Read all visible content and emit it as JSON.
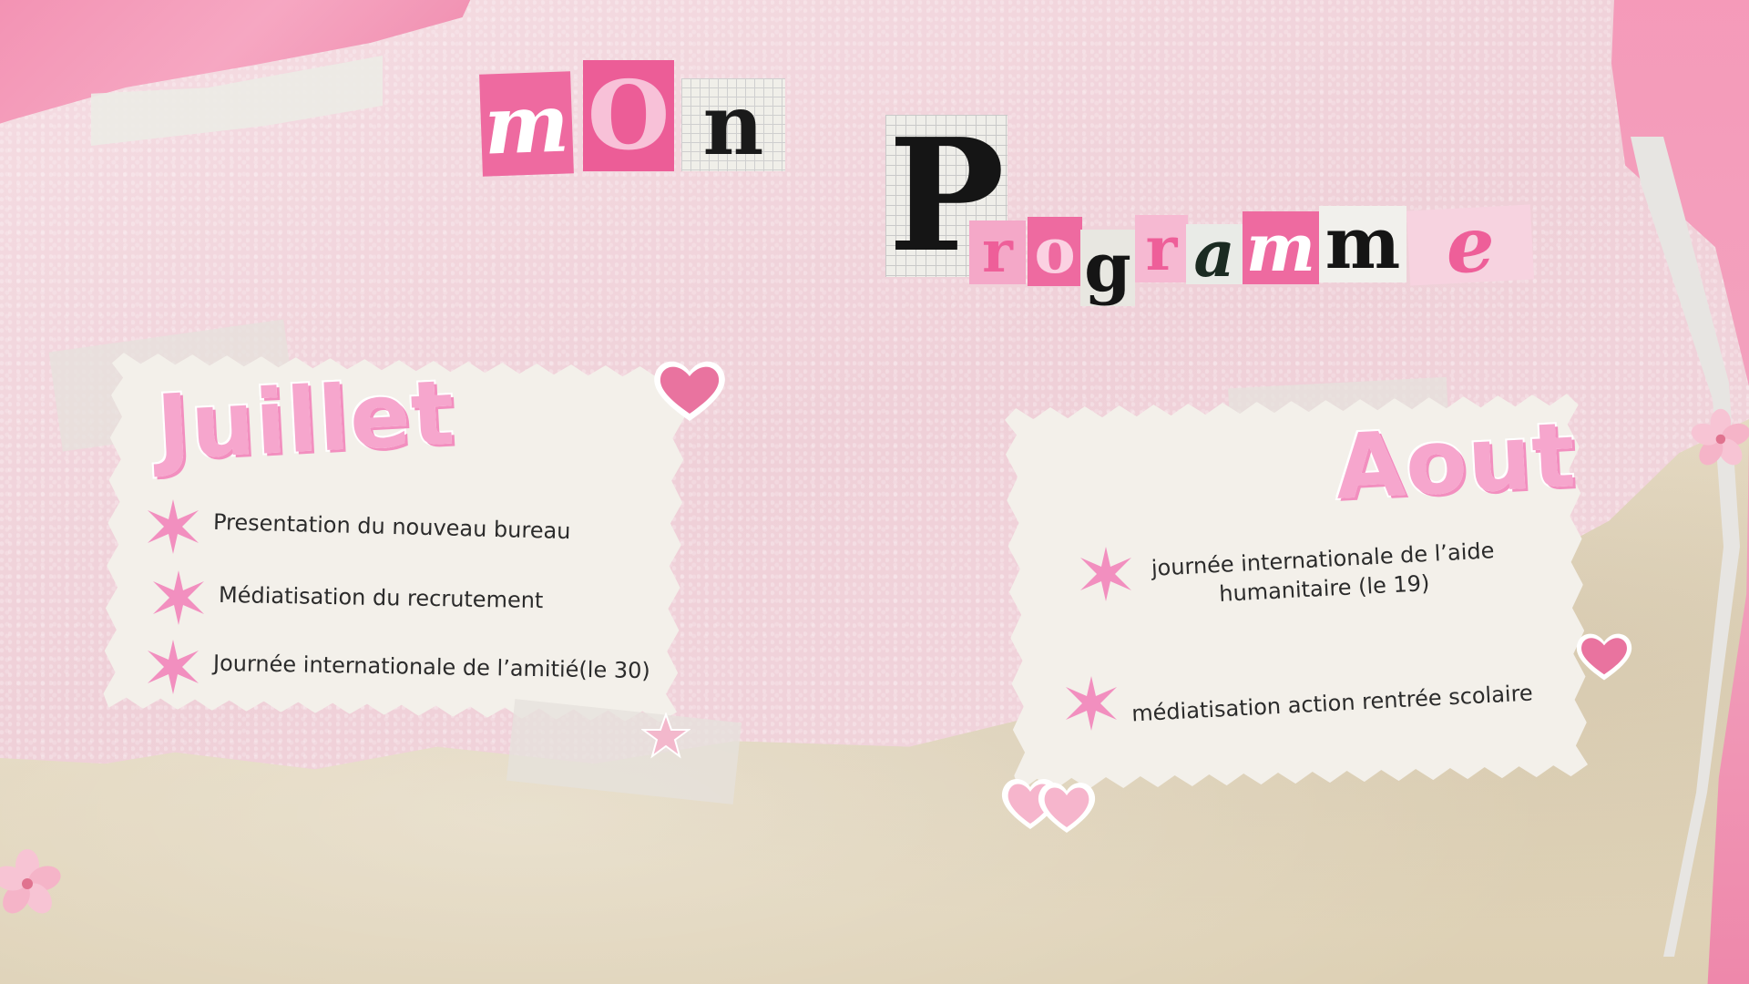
{
  "title": {
    "word1": [
      "m",
      "O",
      "n"
    ],
    "word2": [
      "P",
      "r",
      "o",
      "g",
      "r",
      "a",
      "m",
      "m",
      "e"
    ]
  },
  "sections": [
    {
      "month": "Juillet",
      "items": [
        "Presentation du nouveau bureau",
        "Médiatisation du recrutement",
        "Journée internationale de l’amitié(le 30)"
      ]
    },
    {
      "month": "Aout",
      "items": [
        "journée internationale de l’aide humanitaire (le 19)",
        "médiatisation action rentrée scolaire"
      ]
    }
  ],
  "decor": {
    "bullet_icon": "star-burst-icon",
    "stickers": [
      "heart-icon",
      "double-heart-icon",
      "flower-icon",
      "star-icon"
    ],
    "colors": {
      "accent_pink": "#f28fbf",
      "title_pink": "#f6a6cd",
      "ink": "#1f1f1f",
      "card": "#f3f0ea"
    }
  }
}
